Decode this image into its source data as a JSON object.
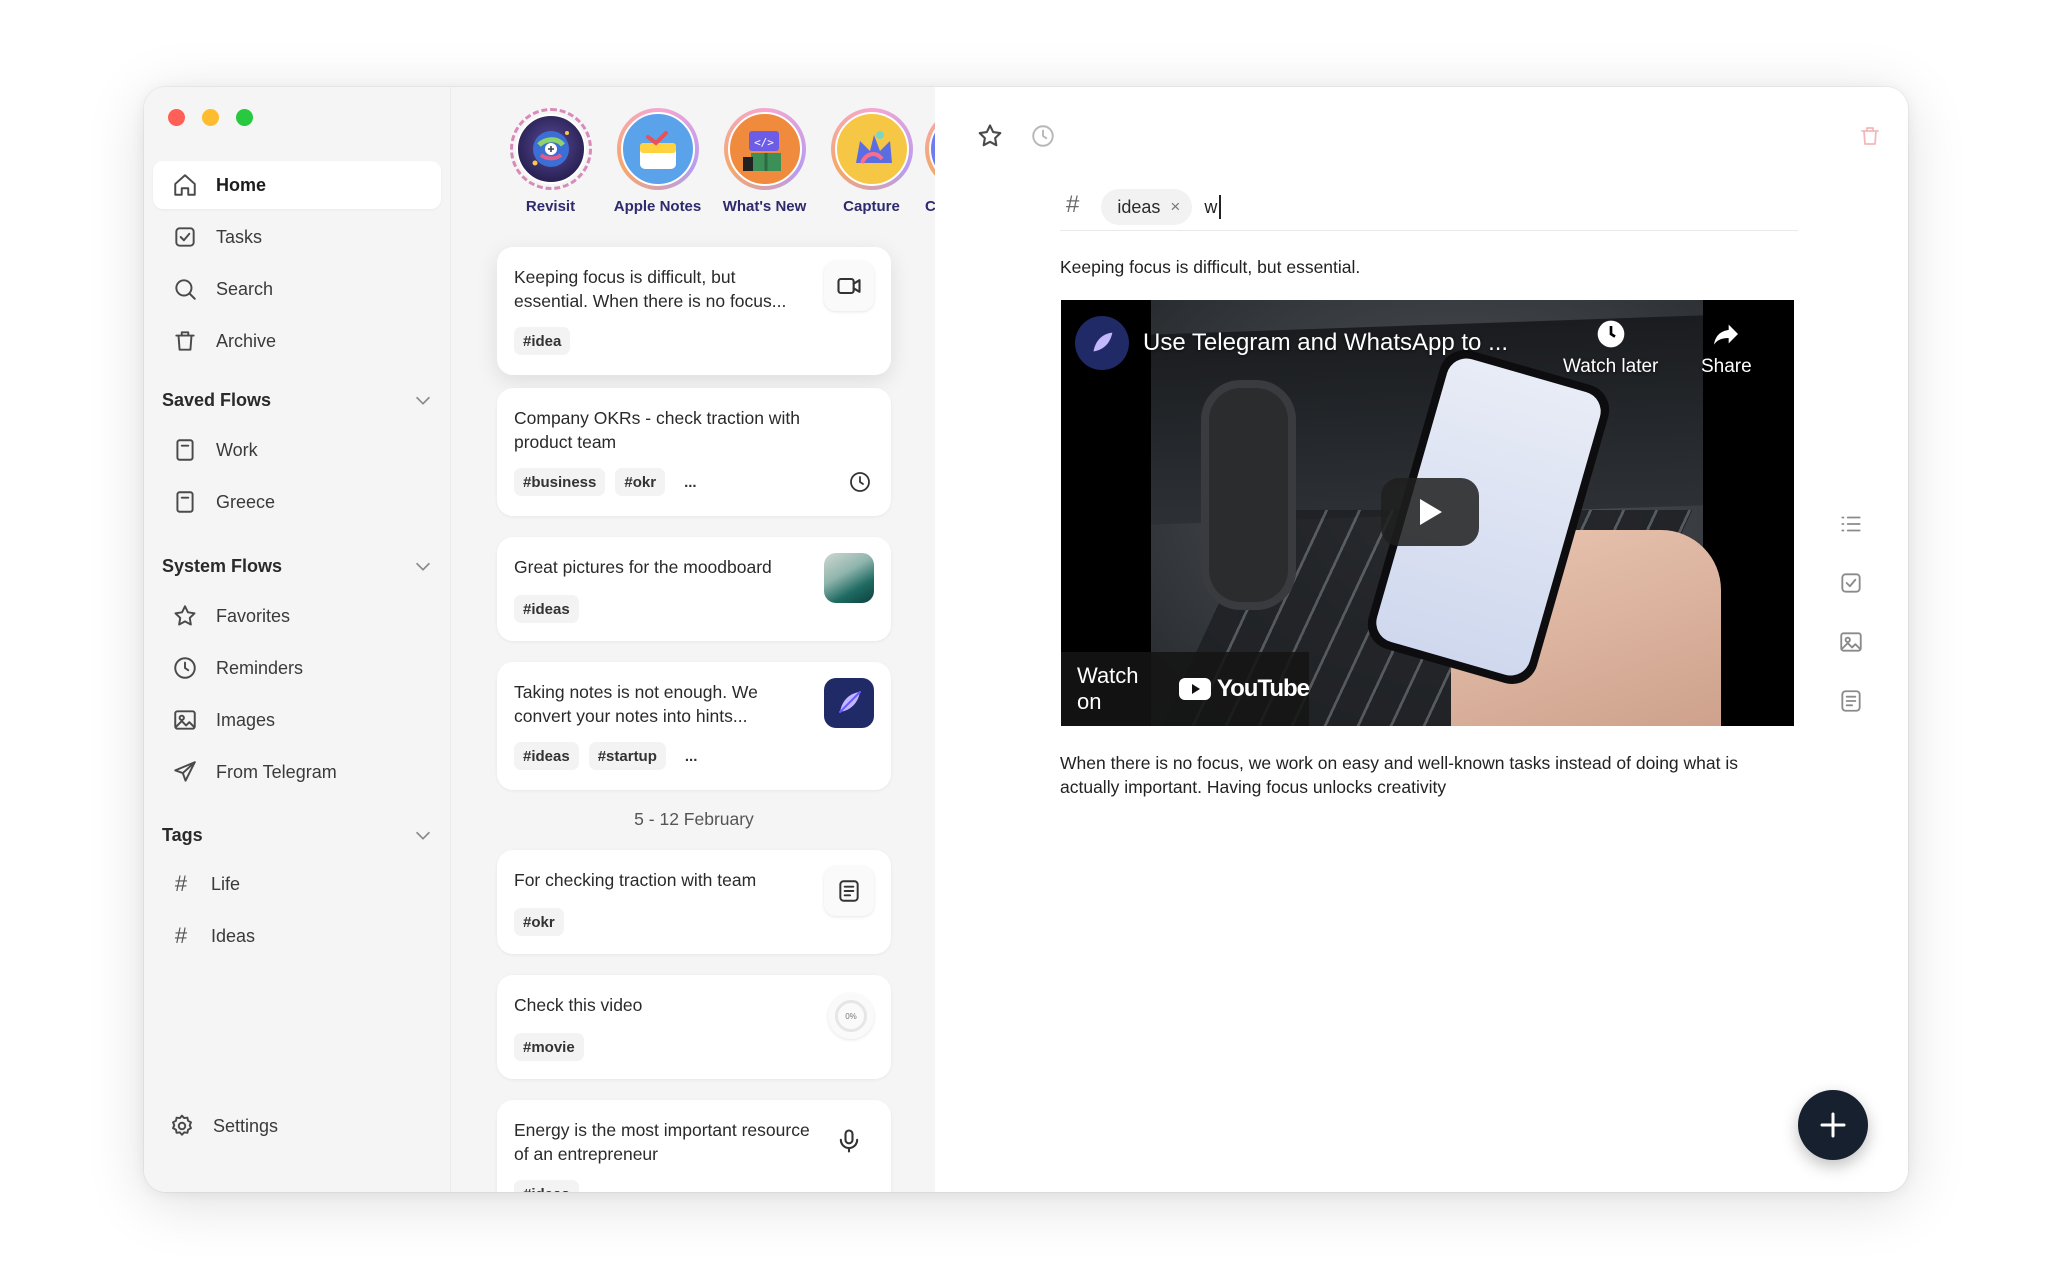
{
  "sidebar": {
    "nav": [
      {
        "label": "Home",
        "icon": "home-icon",
        "active": true
      },
      {
        "label": "Tasks",
        "icon": "checkbox-icon"
      },
      {
        "label": "Search",
        "icon": "search-icon"
      },
      {
        "label": "Archive",
        "icon": "trash-icon"
      }
    ],
    "saved_flows": {
      "title": "Saved Flows",
      "items": [
        "Work",
        "Greece"
      ]
    },
    "system_flows": {
      "title": "System Flows",
      "items": [
        "Favorites",
        "Reminders",
        "Images",
        "From Telegram"
      ]
    },
    "tags": {
      "title": "Tags",
      "items": [
        "Life",
        "Ideas"
      ]
    },
    "settings_label": "Settings"
  },
  "stories": [
    "Revisit",
    "Apple Notes",
    "What's New",
    "Capture",
    "C"
  ],
  "cards": [
    {
      "text": "Keeping focus is difficult, but essential. When there is no focus...",
      "tags": [
        "#idea"
      ],
      "side_icon": "video-camera-icon"
    },
    {
      "text": "Company OKRs - check traction with product team",
      "tags": [
        "#business",
        "#okr",
        "..."
      ],
      "side_icon": "clock-icon"
    },
    {
      "text": "Great pictures for the moodboard",
      "tags": [
        "#ideas"
      ],
      "side_icon": "image-thumbnail"
    },
    {
      "text": "Taking notes is not enough. We convert your notes into hints...",
      "tags": [
        "#ideas",
        "#startup",
        "..."
      ],
      "side_icon": "app-logo-thumbnail"
    },
    {
      "text": "For checking traction with team",
      "tags": [
        "#okr"
      ],
      "side_icon": "document-icon"
    },
    {
      "text": "Check this video",
      "tags": [
        "#movie"
      ],
      "side_icon": "progress-ring",
      "progress_label": "0%"
    },
    {
      "text": "Energy is the most important resource of an entrepreneur",
      "tags": [
        "#ideas"
      ],
      "side_icon": "microphone-icon"
    }
  ],
  "date_separator": "5 - 12 February",
  "detail": {
    "tag_hash": "#",
    "tag_chip": "ideas",
    "chip_close": "×",
    "typed_input": "w",
    "intro": "Keeping focus is difficult, but essential.",
    "video": {
      "title": "Use Telegram and WhatsApp to ...",
      "watch_later": "Watch later",
      "share": "Share",
      "watch_on": "Watch on",
      "brand": "YouTube"
    },
    "body": "When there is no focus, we work on easy and well-known tasks instead of doing what is actually important. Having focus unlocks creativity"
  },
  "colors": {
    "sidebar_bg": "#f5f5f5",
    "fab_bg": "#17202e",
    "trash_accent": "#f4b8b8",
    "story_name": "#2d2a6e"
  }
}
